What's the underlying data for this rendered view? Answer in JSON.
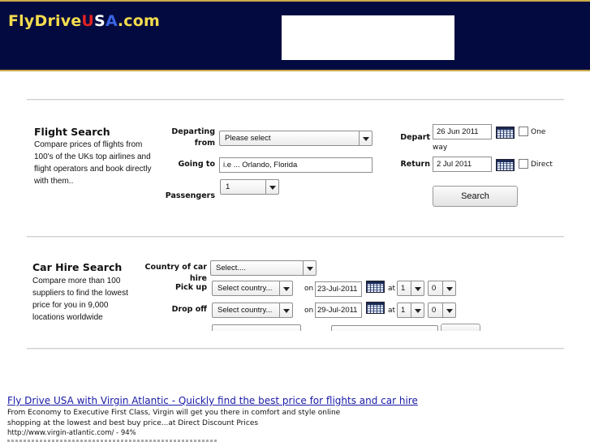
{
  "header": {
    "logo": {
      "part1": "FlyDrive",
      "u": "U",
      "s": "S",
      "a": "A",
      "tld": ".com"
    },
    "colors": {
      "bg": "#030a3f",
      "gold": "#f3dc4e",
      "red": "#e32222",
      "white": "#ffffff",
      "blue": "#3a63e4"
    }
  },
  "flight": {
    "title": "Flight Search",
    "desc": "Compare prices of flights from 100's of the UKs top airlines and flight operators and book directly with them..",
    "departing_label_1": "Departing",
    "departing_label_2": "from",
    "departing_value": "Please select",
    "going_label": "Going to",
    "going_value": "i.e ... Orlando, Florida",
    "passengers_label": "Passengers",
    "passengers_value": "1",
    "depart_label": "Depart",
    "depart_value": "26 Jun 2011",
    "oneway_label_1": "One",
    "oneway_label_2": "way",
    "return_label": "Return",
    "return_value": "2 Jul 2011",
    "direct_label": "Direct",
    "search_button": "Search"
  },
  "car": {
    "title": "Car Hire Search",
    "desc": "Compare more than 100 suppliers to find the lowest price for you in 9,000 locations worldwide",
    "country_label": "Country of car hire",
    "country_value": "Select....",
    "pickup_label": "Pick up",
    "pickup_country": "Select country...",
    "pickup_on": "on",
    "pickup_date": "23-Jul-2011",
    "pickup_at": "at",
    "pickup_hour": "1",
    "pickup_min": "0",
    "dropoff_label": "Drop off",
    "dropoff_country": "Select country...",
    "dropoff_on": "on",
    "dropoff_date": "29-Jul-2011",
    "dropoff_at": "at",
    "dropoff_hour": "1",
    "dropoff_min": "0"
  },
  "result": {
    "link": "Fly Drive USA with Virgin Atlantic - Quickly find the best price for flights and car hire",
    "desc": "From Economy to Executive First Class, Virgin will get you there in comfort and style online shopping at the lowest and best buy price...at Direct Discount Prices",
    "url": "http://www.virgin-atlantic.com/ - 94%"
  }
}
